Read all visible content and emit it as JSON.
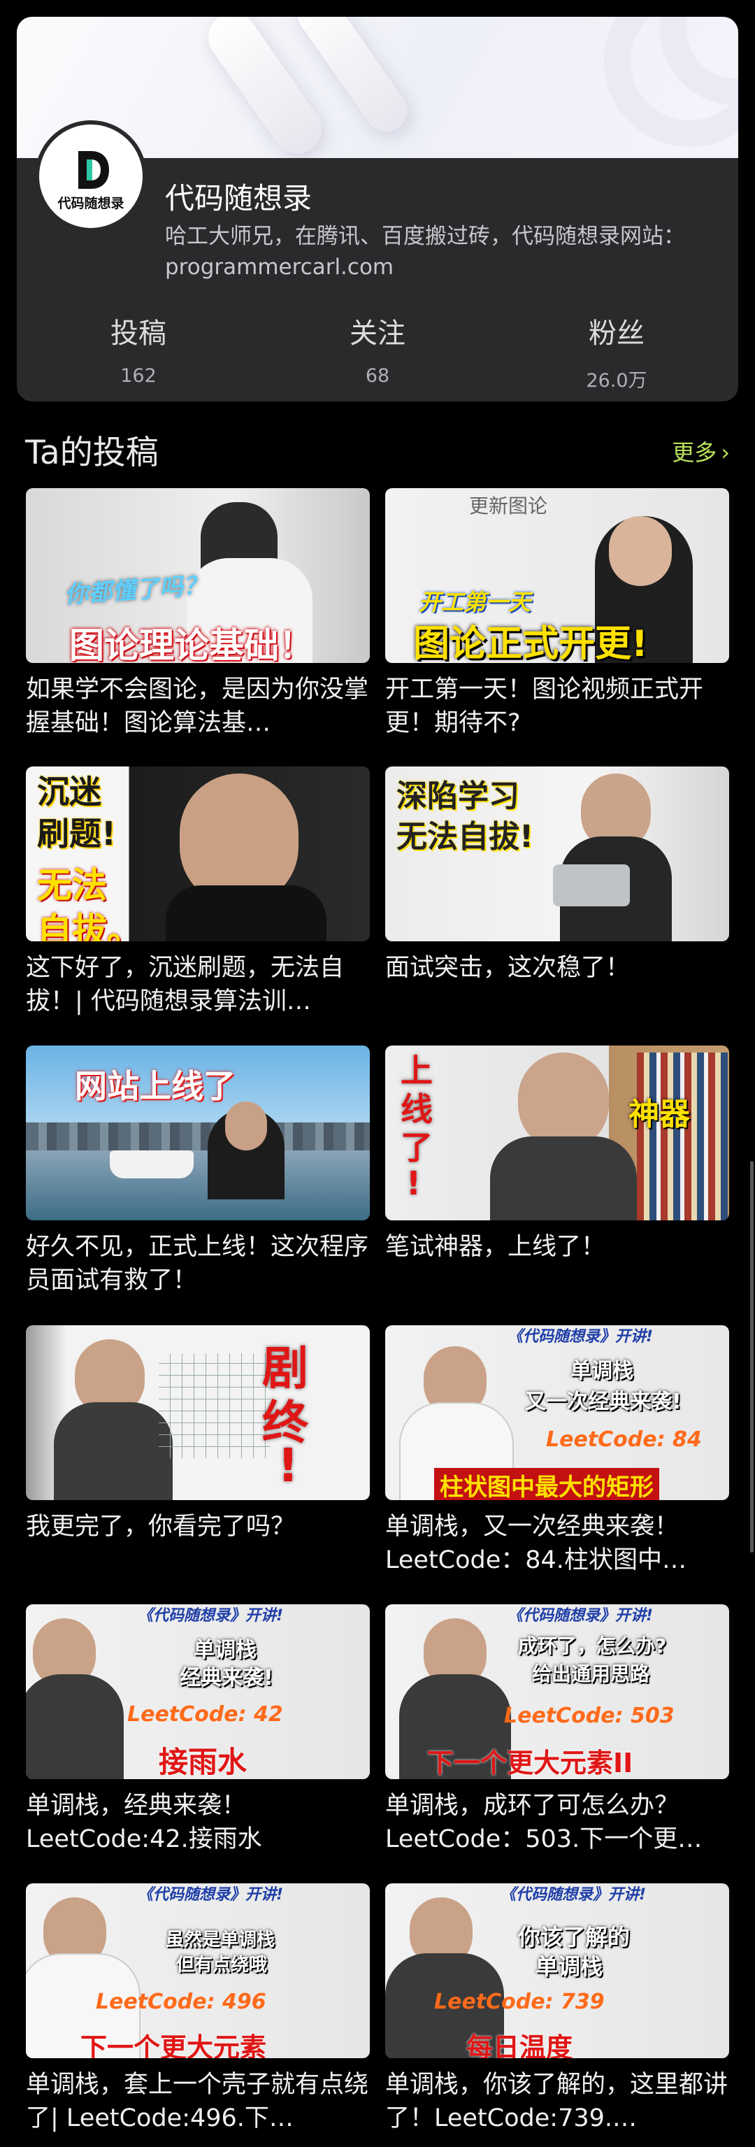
{
  "profile": {
    "avatar_label": "代码随想录",
    "name": "代码随想录",
    "bio": "哈工大师兄，在腾讯、百度搬过砖，代码随想录网站：programmercarl.com",
    "stats": [
      {
        "label": "投稿",
        "value": "162"
      },
      {
        "label": "关注",
        "value": "68"
      },
      {
        "label": "粉丝",
        "value": "26.0万"
      }
    ]
  },
  "section": {
    "title": "Ta的投稿",
    "more_label": "更多"
  },
  "videos": [
    {
      "title": "如果学不会图论，是因为你没掌握基础！图论算法基…",
      "thumb_texts": [
        "你都懂了吗？",
        "图论理论基础！"
      ]
    },
    {
      "title": "开工第一天！图论视频正式开更！期待不?",
      "thumb_texts": [
        "更新图论",
        "开工第一天",
        "图论正式开更!"
      ]
    },
    {
      "title": "这下好了，沉迷刷题，无法自拔！| 代码随想录算法训…",
      "thumb_texts": [
        "沉迷",
        "刷题!",
        "无法",
        "自拔。"
      ]
    },
    {
      "title": "面试突击，这次稳了！",
      "thumb_texts": [
        "深陷学习",
        "无法自拔!"
      ]
    },
    {
      "title": "好久不见，正式上线！这次程序员面试有救了！",
      "thumb_texts": [
        "网站上线了"
      ]
    },
    {
      "title": "笔试神器，上线了！",
      "thumb_texts": [
        "上",
        "线",
        "了",
        "!",
        "神器"
      ]
    },
    {
      "title": "我更完了，你看完了吗？",
      "thumb_texts": [
        "剧",
        "终",
        "!"
      ]
    },
    {
      "title": "单调栈，又一次经典来袭！LeetCode：84.柱状图中…",
      "thumb_texts": [
        "《代码随想录》开讲!",
        "单调栈",
        "又一次经典来袭!",
        "LeetCode: 84",
        "柱状图中最大的矩形"
      ]
    },
    {
      "title": "单调栈，经典来袭！LeetCode:42.接雨水",
      "thumb_texts": [
        "《代码随想录》开讲!",
        "单调栈",
        "经典来袭!",
        "LeetCode: 42",
        "接雨水"
      ]
    },
    {
      "title": "单调栈，成环了可怎么办？LeetCode：503.下一个更…",
      "thumb_texts": [
        "《代码随想录》开讲!",
        "成环了，怎么办?",
        "给出通用思路",
        "LeetCode: 503",
        "下一个更大元素II"
      ]
    },
    {
      "title": "单调栈，套上一个壳子就有点绕了| LeetCode:496.下…",
      "thumb_texts": [
        "《代码随想录》开讲!",
        "虽然是单调栈",
        "但有点绕哦",
        "LeetCode: 496",
        "下一个更大元素"
      ]
    },
    {
      "title": "单调栈，你该了解的，这里都讲了！LeetCode:739.…",
      "thumb_texts": [
        "《代码随想录》开讲!",
        "你该了解的",
        "单调栈",
        "LeetCode: 739",
        "每日温度"
      ]
    }
  ]
}
